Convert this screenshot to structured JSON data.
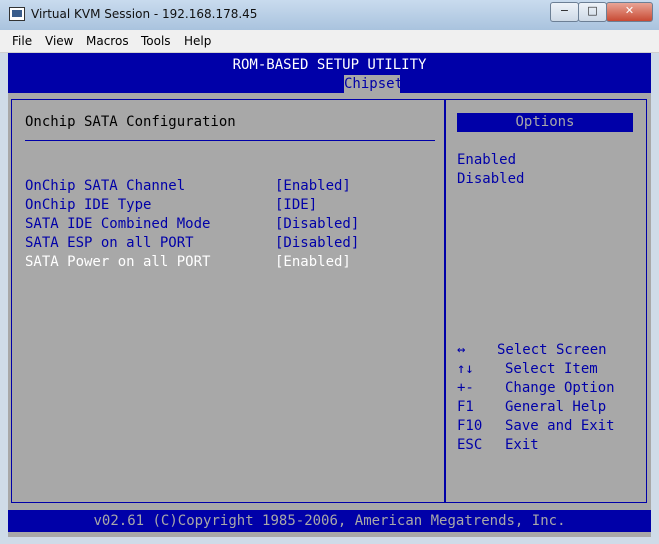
{
  "window": {
    "title": "Virtual KVM Session - 192.168.178.45",
    "min_label": "−",
    "max_label": "□",
    "close_label": "✕"
  },
  "menu": [
    "File",
    "View",
    "Macros",
    "Tools",
    "Help"
  ],
  "bios": {
    "title": "ROM-BASED SETUP UTILITY",
    "tab": "Chipset",
    "section_title": "Onchip SATA Configuration",
    "settings": [
      {
        "label": "OnChip SATA Channel",
        "value": "[Enabled]"
      },
      {
        "label": "OnChip IDE Type",
        "value": "[IDE]"
      },
      {
        "label": "SATA IDE Combined Mode",
        "value": "[Disabled]"
      },
      {
        "label": "SATA ESP on all PORT",
        "value": "[Disabled]"
      },
      {
        "label": "SATA Power on all PORT",
        "value": "[Enabled]"
      }
    ],
    "selected_index": 4,
    "options_title": "Options",
    "options": [
      "Enabled",
      "Disabled"
    ],
    "keys": [
      {
        "key": "↔",
        "desc": "Select Screen"
      },
      {
        "key": "↑↓",
        "desc": "Select Item"
      },
      {
        "key": "+-",
        "desc": "Change Option"
      },
      {
        "key": "F1",
        "desc": "General Help"
      },
      {
        "key": "F10",
        "desc": "Save and Exit"
      },
      {
        "key": "ESC",
        "desc": "Exit"
      }
    ],
    "footer": "v02.61 (C)Copyright 1985-2006, American Megatrends, Inc."
  },
  "colors": {
    "bios_blue": "#0000a8",
    "bios_gray": "#a8a8a8",
    "highlight": "#ffffff"
  }
}
